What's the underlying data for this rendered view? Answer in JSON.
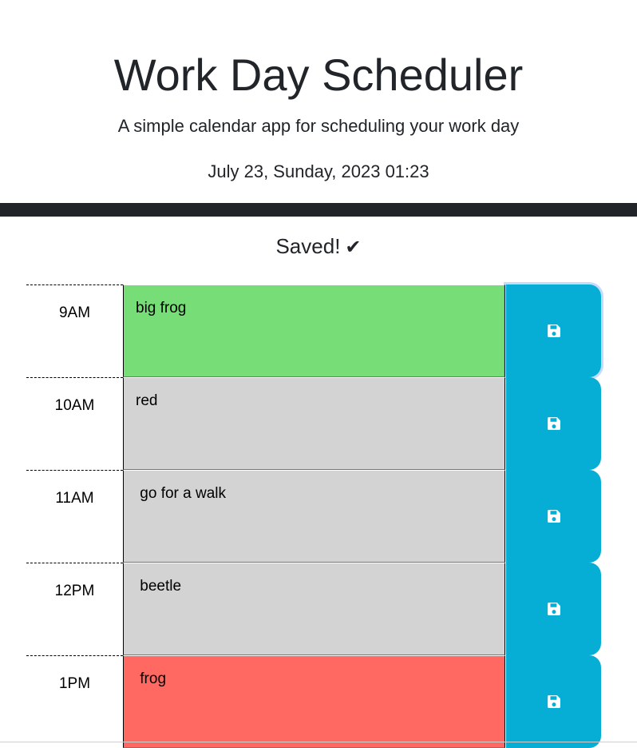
{
  "header": {
    "title": "Work Day Scheduler",
    "subtitle": "A simple calendar app for scheduling your work day",
    "current_date": "July 23, Sunday, 2023 01:23"
  },
  "status": {
    "saved_message": "Saved!",
    "check_icon": "check-icon"
  },
  "time_blocks": [
    {
      "hour": "9AM",
      "text": "big frog",
      "state": "present"
    },
    {
      "hour": "10AM",
      "text": "red",
      "state": "past"
    },
    {
      "hour": "11AM",
      "text": " go for a walk",
      "state": "past"
    },
    {
      "hour": "12PM",
      "text": " beetle",
      "state": "past"
    },
    {
      "hour": "1PM",
      "text": " frog",
      "state": "future"
    }
  ],
  "save_icon": "floppy-disk-icon",
  "colors": {
    "past": "#d3d3d3",
    "present": "#77dd77",
    "future": "#ff6961",
    "save_button": "#06aed5",
    "divider": "#212529"
  }
}
